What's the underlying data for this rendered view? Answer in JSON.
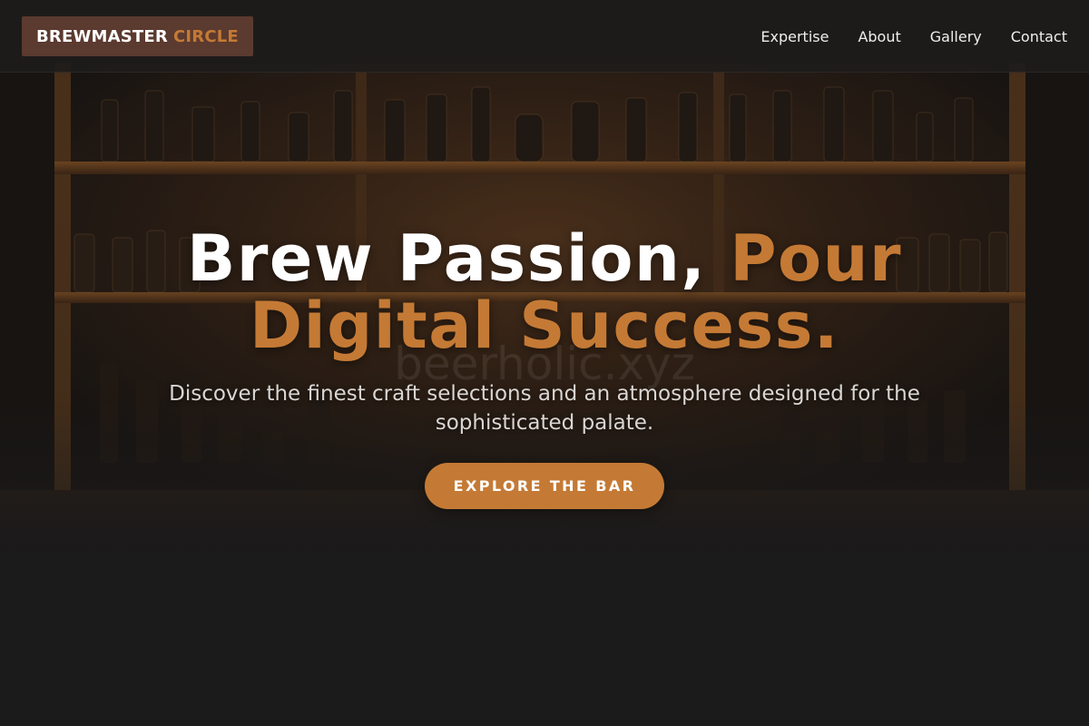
{
  "header": {
    "brand_main": "BREWMASTER",
    "brand_accent": "CIRCLE",
    "nav": [
      {
        "label": "Expertise"
      },
      {
        "label": "About"
      },
      {
        "label": "Gallery"
      },
      {
        "label": "Contact"
      }
    ]
  },
  "hero": {
    "title_part1": "Brew Passion,",
    "title_accent": "Pour Digital Success.",
    "subtitle": "Discover the finest craft selections and an atmosphere designed for the sophisticated palate.",
    "cta_label": "EXPLORE THE BAR",
    "watermark": "beerholic.xyz"
  },
  "colors": {
    "accent": "#c47a35",
    "brand_bg": "#5b3a2f",
    "background": "#1c1b1b"
  }
}
